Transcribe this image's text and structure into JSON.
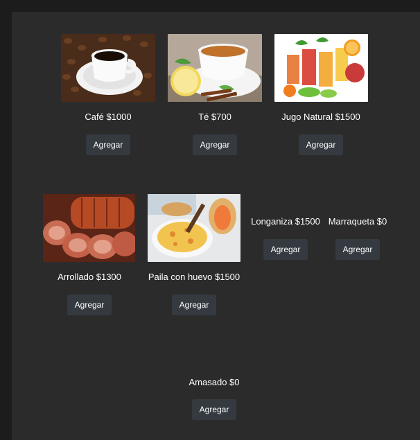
{
  "products": [
    {
      "label": "Café $1000",
      "button": "Agregar",
      "image": "coffee-cup"
    },
    {
      "label": "Té $700",
      "button": "Agregar",
      "image": "tea-cup"
    },
    {
      "label": "Jugo Natural $1500",
      "button": "Agregar",
      "image": "juices"
    },
    {
      "label": "Arrollado $1300",
      "button": "Agregar",
      "image": "sliced-meat-roll"
    },
    {
      "label": "Paila con huevo $1500",
      "button": "Agregar",
      "image": "egg-pan"
    },
    {
      "label": "Longaniza $1500",
      "button": "Agregar"
    },
    {
      "label": "Marraqueta $0",
      "button": "Agregar"
    },
    {
      "label": "Amasado $0",
      "button": "Agregar"
    }
  ],
  "colors": {
    "background": "#1c1c1c",
    "panel": "#2b2b2b",
    "button": "#343a40",
    "text": "#ffffff"
  }
}
